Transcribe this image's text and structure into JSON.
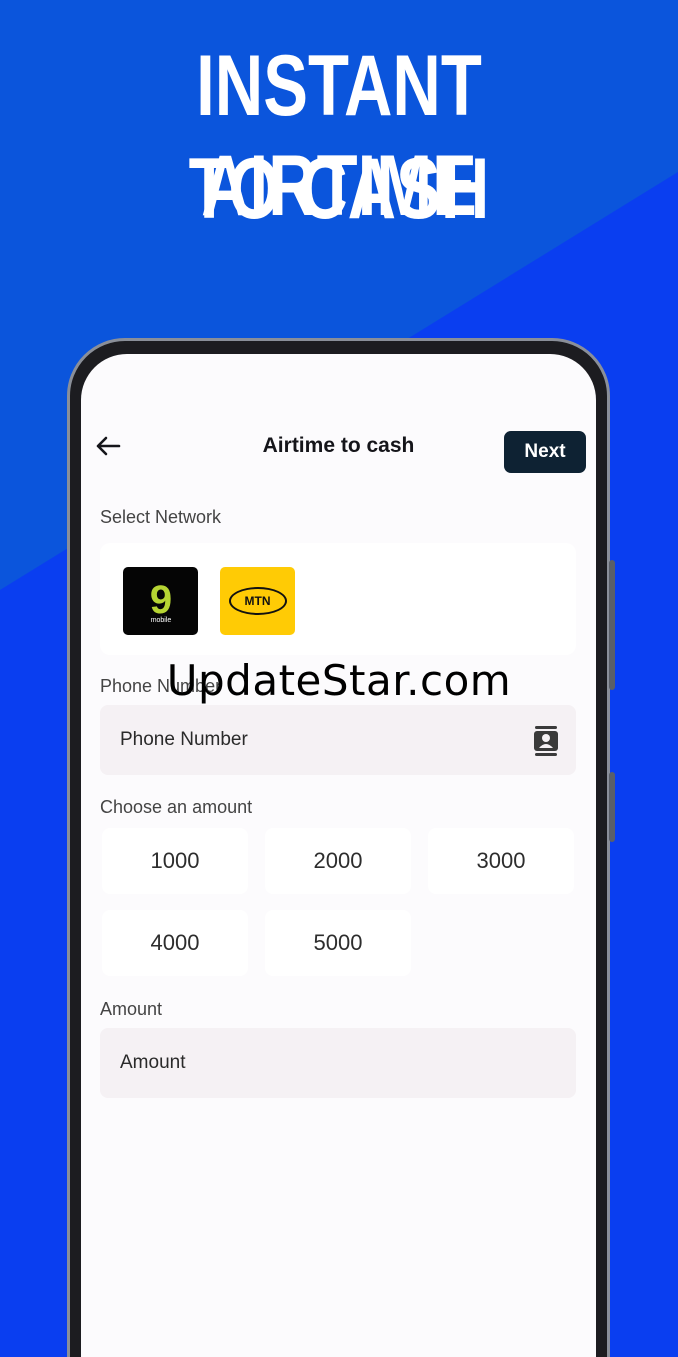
{
  "banner": {
    "line1": "INSTANT AIRTIME",
    "line2": "TO CASH"
  },
  "header": {
    "title": "Airtime to cash",
    "next_label": "Next",
    "back_icon": "arrow-left-icon"
  },
  "network": {
    "label": "Select Network",
    "options": [
      {
        "name": "9mobile",
        "glyph": "9",
        "sub": "mobile",
        "color": "#050505",
        "accent": "#b6d433"
      },
      {
        "name": "MTN",
        "glyph": "MTN",
        "color": "#ffcb05"
      }
    ]
  },
  "phone": {
    "label": "Phone Number",
    "placeholder": "Phone Number",
    "icon": "contacts-icon"
  },
  "amounts": {
    "label": "Choose an amount",
    "options": [
      "1000",
      "2000",
      "3000",
      "4000",
      "5000"
    ]
  },
  "amount": {
    "label": "Amount",
    "placeholder": "Amount"
  },
  "watermark": "UpdateStar.com",
  "colors": {
    "background_top": "#0b55dc",
    "background_bottom": "#0a3ef0",
    "next_button": "#0e2233",
    "field_bg": "#f5f1f4"
  }
}
